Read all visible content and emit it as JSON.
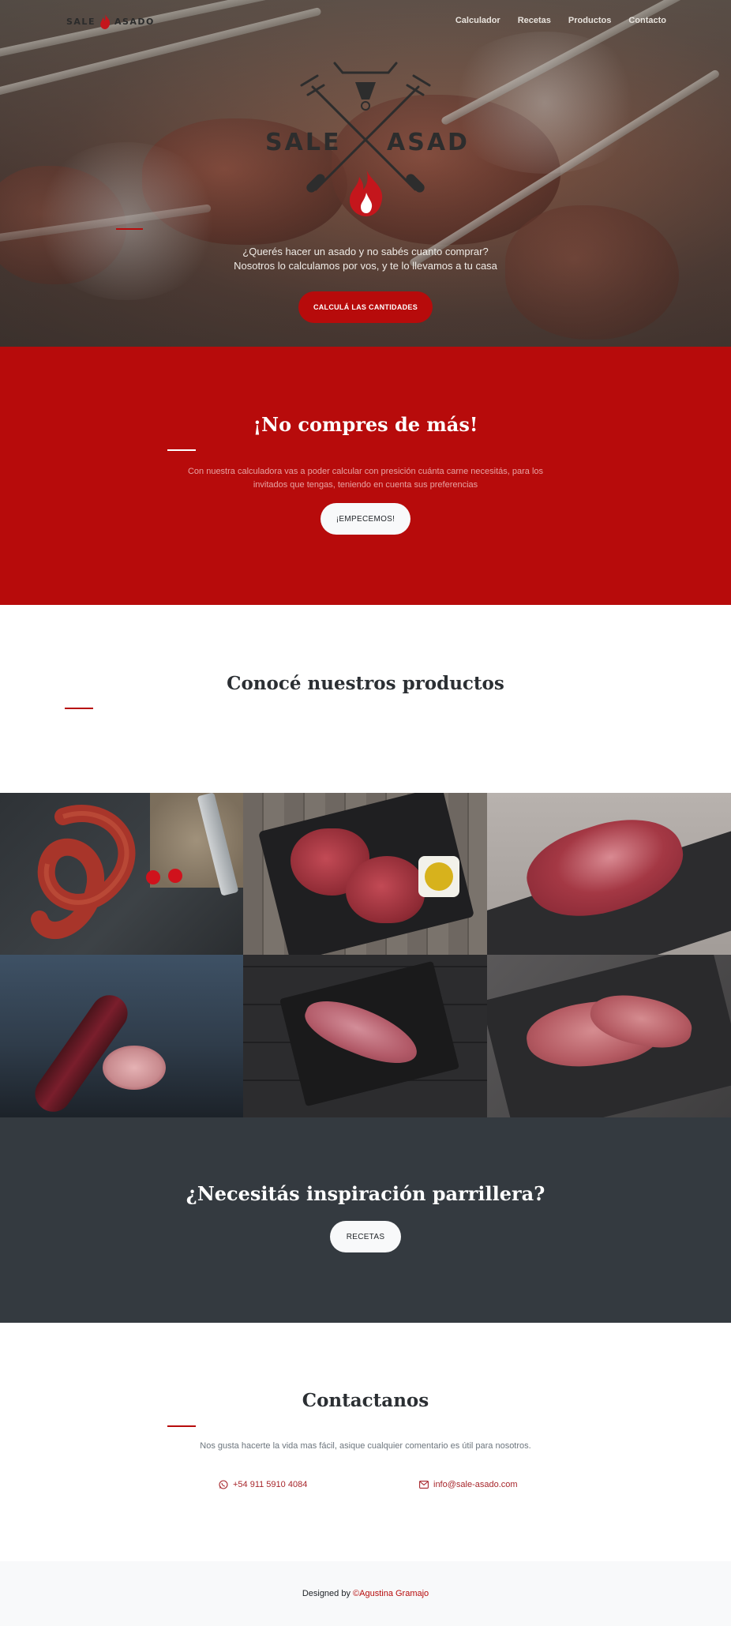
{
  "nav": {
    "brand_left": "SALE",
    "brand_right": "ASADO",
    "links": [
      "Calculador",
      "Recetas",
      "Productos",
      "Contacto"
    ]
  },
  "hero": {
    "logo_left": "SALE",
    "logo_right": "ASADO",
    "line1": "¿Querés hacer un asado y no sabés cuanto comprar?",
    "line2": "Nosotros lo calculamos por vos, y te lo llevamos a tu casa",
    "button": "CALCULÁ LAS CANTIDADES"
  },
  "calc": {
    "title": "¡No compres de más!",
    "text": "Con nuestra calculadora vas a poder calcular con presición cuánta carne necesitás, para los invitados que tengas, teniendo en cuenta sus preferencias",
    "button": "¡EMPECEMOS!"
  },
  "products": {
    "title": "Conocé nuestros productos",
    "items": [
      "chorizo",
      "bife",
      "asado",
      "morcilla",
      "lomo",
      "vacio"
    ]
  },
  "inspiration": {
    "title": "¿Necesitás inspiración parrillera?",
    "button": "RECETAS"
  },
  "contact": {
    "title": "Contactanos",
    "text": "Nos gusta hacerte la vida mas fácil, asique cualquier comentario es útil para nosotros.",
    "phone": "+54 911 5910 4084",
    "email": "info@sale-asado.com"
  },
  "footer": {
    "prefix": "Designed by ",
    "author": "©Agustina Gramajo"
  },
  "colors": {
    "brand_red": "#b70b0b",
    "dark": "#343a40",
    "light": "#f8f9fa"
  }
}
